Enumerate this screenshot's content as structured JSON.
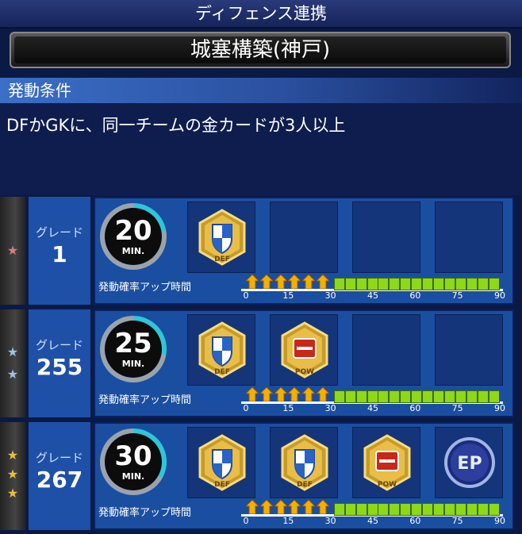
{
  "header": {
    "title": "ディフェンス連携"
  },
  "combo": {
    "name": "城塞構築(神戸)"
  },
  "condition": {
    "label": "発動条件",
    "text": "DFかGKに、同一チームの金カードが3人以上"
  },
  "grades": [
    {
      "stars": 1,
      "star_color": "#d08080",
      "grade_label": "グレード",
      "grade_value": "1",
      "timer_value": "20",
      "timer_unit": "MIN.",
      "badges": [
        {
          "type": "def",
          "label": "DEF"
        }
      ],
      "bar_label": "発動確率アップ時間",
      "bar_ticks": [
        "0",
        "15",
        "30",
        "45",
        "60",
        "75",
        "90"
      ],
      "boost_until": 30
    },
    {
      "stars": 2,
      "star_color": "#9fc2e0",
      "grade_label": "グレード",
      "grade_value": "255",
      "timer_value": "25",
      "timer_unit": "MIN.",
      "badges": [
        {
          "type": "def",
          "label": "DEF"
        },
        {
          "type": "pow",
          "label": "POW"
        }
      ],
      "bar_label": "発動確率アップ時間",
      "bar_ticks": [
        "0",
        "15",
        "30",
        "45",
        "60",
        "75",
        "90"
      ],
      "boost_until": 30
    },
    {
      "stars": 3,
      "star_color": "#e8c040",
      "grade_label": "グレード",
      "grade_value": "267",
      "timer_value": "30",
      "timer_unit": "MIN.",
      "badges": [
        {
          "type": "def",
          "label": "DEF"
        },
        {
          "type": "def",
          "label": "DEF"
        },
        {
          "type": "pow",
          "label": "POW"
        },
        {
          "type": "ep",
          "label": "EP"
        }
      ],
      "bar_label": "発動確率アップ時間",
      "bar_ticks": [
        "0",
        "15",
        "30",
        "45",
        "60",
        "75",
        "90"
      ],
      "boost_until": 30
    }
  ]
}
